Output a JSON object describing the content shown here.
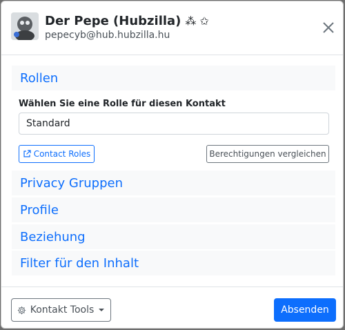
{
  "header": {
    "name": "Der Pepe (Hubzilla)",
    "name_badges": "⁂ ✩",
    "handle": "pepecyb@hub.hubzilla.hu"
  },
  "sections": {
    "roles": "Rollen",
    "privacy": "Privacy Gruppen",
    "profile": "Profile",
    "relationship": "Beziehung",
    "filter": "Filter für den Inhalt"
  },
  "roles": {
    "select_label": "Wählen Sie eine Rolle für diesen Kontakt",
    "selected": "Standard",
    "contact_roles_button": "Contact Roles",
    "compare_button": "Berechtigungen vergleichen"
  },
  "footer": {
    "tools_button": "Kontakt Tools",
    "submit_button": "Absenden"
  },
  "colors": {
    "accent": "#0d6efd",
    "section_bg": "#f8f9fa"
  }
}
